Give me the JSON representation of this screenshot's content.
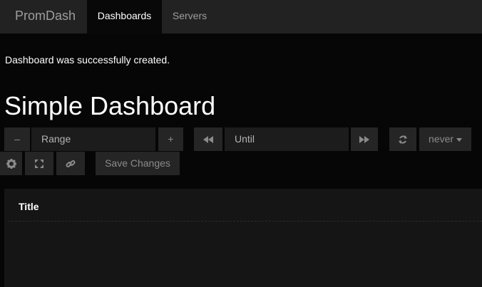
{
  "navbar": {
    "brand": "PromDash",
    "items": [
      {
        "label": "Dashboards",
        "active": true
      },
      {
        "label": "Servers",
        "active": false
      }
    ]
  },
  "flash_message": "Dashboard was successfully created.",
  "dashboard": {
    "title": "Simple Dashboard"
  },
  "controls": {
    "range_decrease_label": "–",
    "range_placeholder": "Range",
    "range_increase_label": "+",
    "until_placeholder": "Until",
    "refresh_value": "never",
    "save_label": "Save Changes"
  },
  "icons": {
    "rewind": "rewind-icon",
    "fast_forward": "fast-forward-icon",
    "refresh": "refresh-icon",
    "caret": "caret-down-icon",
    "settings": "gear-icon",
    "fullscreen": "fullscreen-icon",
    "link": "link-icon"
  },
  "panel": {
    "title": "Title"
  },
  "colors": {
    "background": "#060606",
    "navbar": "#222222",
    "control": "#252525",
    "panel": "#151515"
  }
}
